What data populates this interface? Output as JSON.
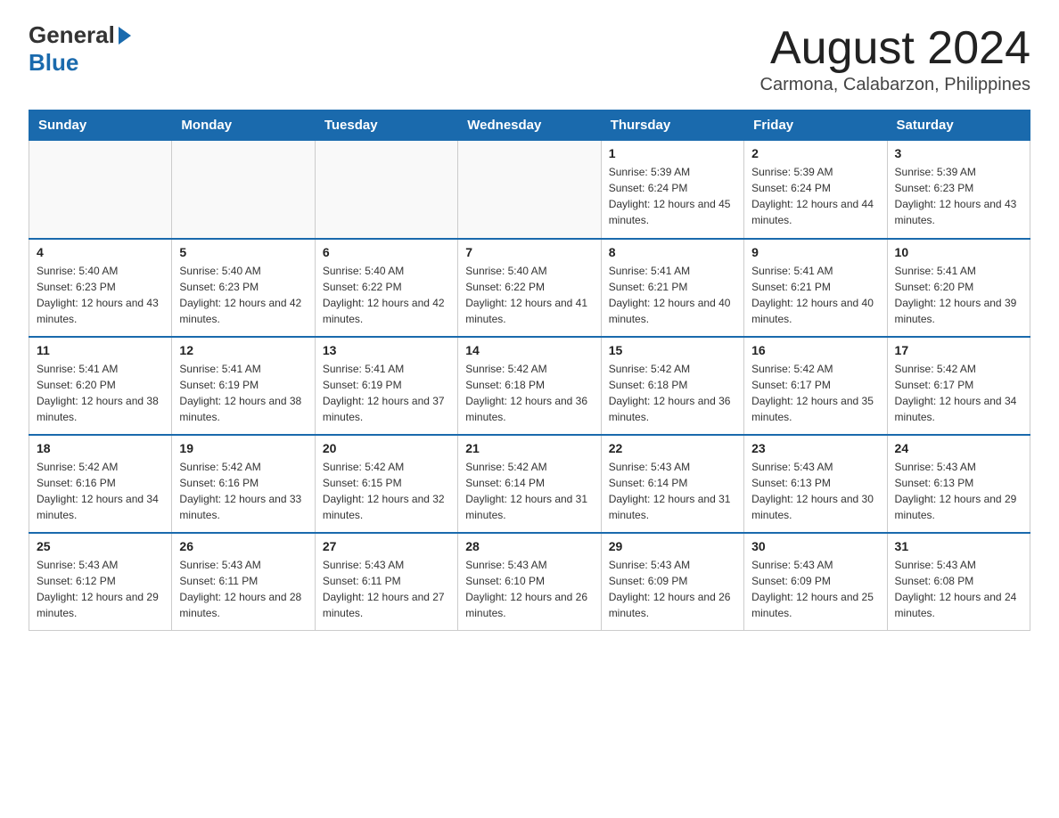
{
  "header": {
    "logo_general": "General",
    "logo_blue": "Blue",
    "month_title": "August 2024",
    "location": "Carmona, Calabarzon, Philippines"
  },
  "days_of_week": [
    "Sunday",
    "Monday",
    "Tuesday",
    "Wednesday",
    "Thursday",
    "Friday",
    "Saturday"
  ],
  "weeks": [
    [
      {
        "day": "",
        "info": ""
      },
      {
        "day": "",
        "info": ""
      },
      {
        "day": "",
        "info": ""
      },
      {
        "day": "",
        "info": ""
      },
      {
        "day": "1",
        "info": "Sunrise: 5:39 AM\nSunset: 6:24 PM\nDaylight: 12 hours and 45 minutes."
      },
      {
        "day": "2",
        "info": "Sunrise: 5:39 AM\nSunset: 6:24 PM\nDaylight: 12 hours and 44 minutes."
      },
      {
        "day": "3",
        "info": "Sunrise: 5:39 AM\nSunset: 6:23 PM\nDaylight: 12 hours and 43 minutes."
      }
    ],
    [
      {
        "day": "4",
        "info": "Sunrise: 5:40 AM\nSunset: 6:23 PM\nDaylight: 12 hours and 43 minutes."
      },
      {
        "day": "5",
        "info": "Sunrise: 5:40 AM\nSunset: 6:23 PM\nDaylight: 12 hours and 42 minutes."
      },
      {
        "day": "6",
        "info": "Sunrise: 5:40 AM\nSunset: 6:22 PM\nDaylight: 12 hours and 42 minutes."
      },
      {
        "day": "7",
        "info": "Sunrise: 5:40 AM\nSunset: 6:22 PM\nDaylight: 12 hours and 41 minutes."
      },
      {
        "day": "8",
        "info": "Sunrise: 5:41 AM\nSunset: 6:21 PM\nDaylight: 12 hours and 40 minutes."
      },
      {
        "day": "9",
        "info": "Sunrise: 5:41 AM\nSunset: 6:21 PM\nDaylight: 12 hours and 40 minutes."
      },
      {
        "day": "10",
        "info": "Sunrise: 5:41 AM\nSunset: 6:20 PM\nDaylight: 12 hours and 39 minutes."
      }
    ],
    [
      {
        "day": "11",
        "info": "Sunrise: 5:41 AM\nSunset: 6:20 PM\nDaylight: 12 hours and 38 minutes."
      },
      {
        "day": "12",
        "info": "Sunrise: 5:41 AM\nSunset: 6:19 PM\nDaylight: 12 hours and 38 minutes."
      },
      {
        "day": "13",
        "info": "Sunrise: 5:41 AM\nSunset: 6:19 PM\nDaylight: 12 hours and 37 minutes."
      },
      {
        "day": "14",
        "info": "Sunrise: 5:42 AM\nSunset: 6:18 PM\nDaylight: 12 hours and 36 minutes."
      },
      {
        "day": "15",
        "info": "Sunrise: 5:42 AM\nSunset: 6:18 PM\nDaylight: 12 hours and 36 minutes."
      },
      {
        "day": "16",
        "info": "Sunrise: 5:42 AM\nSunset: 6:17 PM\nDaylight: 12 hours and 35 minutes."
      },
      {
        "day": "17",
        "info": "Sunrise: 5:42 AM\nSunset: 6:17 PM\nDaylight: 12 hours and 34 minutes."
      }
    ],
    [
      {
        "day": "18",
        "info": "Sunrise: 5:42 AM\nSunset: 6:16 PM\nDaylight: 12 hours and 34 minutes."
      },
      {
        "day": "19",
        "info": "Sunrise: 5:42 AM\nSunset: 6:16 PM\nDaylight: 12 hours and 33 minutes."
      },
      {
        "day": "20",
        "info": "Sunrise: 5:42 AM\nSunset: 6:15 PM\nDaylight: 12 hours and 32 minutes."
      },
      {
        "day": "21",
        "info": "Sunrise: 5:42 AM\nSunset: 6:14 PM\nDaylight: 12 hours and 31 minutes."
      },
      {
        "day": "22",
        "info": "Sunrise: 5:43 AM\nSunset: 6:14 PM\nDaylight: 12 hours and 31 minutes."
      },
      {
        "day": "23",
        "info": "Sunrise: 5:43 AM\nSunset: 6:13 PM\nDaylight: 12 hours and 30 minutes."
      },
      {
        "day": "24",
        "info": "Sunrise: 5:43 AM\nSunset: 6:13 PM\nDaylight: 12 hours and 29 minutes."
      }
    ],
    [
      {
        "day": "25",
        "info": "Sunrise: 5:43 AM\nSunset: 6:12 PM\nDaylight: 12 hours and 29 minutes."
      },
      {
        "day": "26",
        "info": "Sunrise: 5:43 AM\nSunset: 6:11 PM\nDaylight: 12 hours and 28 minutes."
      },
      {
        "day": "27",
        "info": "Sunrise: 5:43 AM\nSunset: 6:11 PM\nDaylight: 12 hours and 27 minutes."
      },
      {
        "day": "28",
        "info": "Sunrise: 5:43 AM\nSunset: 6:10 PM\nDaylight: 12 hours and 26 minutes."
      },
      {
        "day": "29",
        "info": "Sunrise: 5:43 AM\nSunset: 6:09 PM\nDaylight: 12 hours and 26 minutes."
      },
      {
        "day": "30",
        "info": "Sunrise: 5:43 AM\nSunset: 6:09 PM\nDaylight: 12 hours and 25 minutes."
      },
      {
        "day": "31",
        "info": "Sunrise: 5:43 AM\nSunset: 6:08 PM\nDaylight: 12 hours and 24 minutes."
      }
    ]
  ]
}
